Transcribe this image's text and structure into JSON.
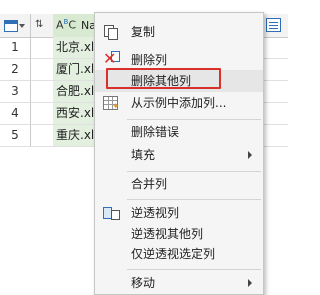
{
  "grid": {
    "row_numbers": [
      "1",
      "2",
      "3",
      "4",
      "5"
    ],
    "column_header_b": "Nar",
    "column_type_icon": "ABC",
    "cells": [
      "北京.xls",
      "厦门.xls",
      "合肥.xls",
      "西安.xls",
      "重庆.xls"
    ]
  },
  "context_menu": {
    "items": [
      {
        "label": "复制",
        "icon": "copy-icon"
      },
      {
        "label": "删除列",
        "icon": "delete-column-icon"
      },
      {
        "label": "删除其他列",
        "icon": ""
      },
      {
        "label": "从示例中添加列...",
        "icon": "add-column-from-examples-icon"
      },
      {
        "label": "删除错误",
        "icon": ""
      },
      {
        "label": "填充",
        "icon": "",
        "submenu": true
      },
      {
        "label": "合并列",
        "icon": ""
      },
      {
        "label": "逆透视列",
        "icon": "unpivot-icon"
      },
      {
        "label": "逆透视其他列",
        "icon": ""
      },
      {
        "label": "仅逆透视选定列",
        "icon": ""
      },
      {
        "label": "移动",
        "icon": "",
        "submenu": true
      }
    ],
    "highlighted_item": "删除其他列",
    "highlight_color": "#d9302c"
  }
}
